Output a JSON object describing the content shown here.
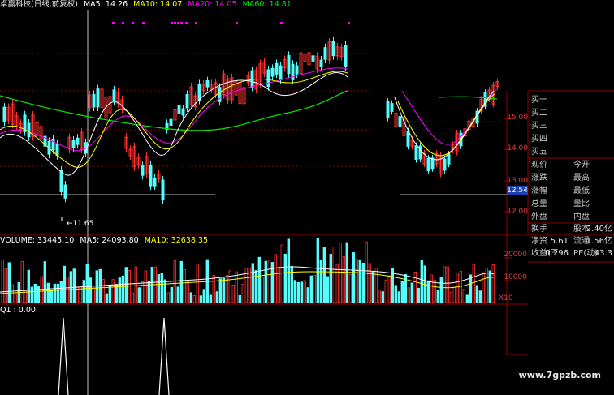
{
  "header": {
    "title": "卓赢科技(日线,前复权)",
    "ma5": "MA5: 14.26",
    "ma10": "MA10: 14.07",
    "ma20": "MA20: 14.05",
    "ma60": "MA60: 14.81"
  },
  "volume_header": {
    "volume": "VOLUME: 33445.10",
    "ma5": "MA5: 24093.80",
    "ma10": "MA10: 32638.35"
  },
  "indicator_header": "Q1 : 0.00",
  "low_marker": "11.65",
  "price_axis": [
    "15.00",
    "14.00",
    "13.00",
    "12.00"
  ],
  "volume_axis": [
    "20000",
    "10000"
  ],
  "volume_unit": "X10",
  "current_price_tag": "12.54",
  "order_book": [
    "买一",
    "买二",
    "买三",
    "买四",
    "买五"
  ],
  "quote": [
    {
      "l1": "现价",
      "v1": "",
      "l2": "今开",
      "v2": ""
    },
    {
      "l1": "涨跌",
      "v1": "",
      "l2": "最高",
      "v2": ""
    },
    {
      "l1": "涨幅",
      "v1": "",
      "l2": "最低",
      "v2": ""
    },
    {
      "l1": "总量",
      "v1": "",
      "l2": "量比",
      "v2": ""
    },
    {
      "l1": "外盘",
      "v1": "",
      "l2": "内盘",
      "v2": ""
    },
    {
      "l1": "换手",
      "v1": "",
      "l2": "股本",
      "v2": "2.40亿"
    },
    {
      "l1": "净资",
      "v1": "5.61",
      "l2": "流通",
      "v2": "1.56亿"
    },
    {
      "l1": "收益(三",
      "v1": "0.296",
      "l2": "PE(动)",
      "v2": "43.3"
    }
  ],
  "watermark": "www.7gpzb.com",
  "colors": {
    "up": "#ff3232",
    "down": "#54fcfc",
    "ma5": "#ffffff",
    "ma10": "#ffff00",
    "ma20": "#ff00ff",
    "ma60": "#00e600",
    "grid": "#8b0000"
  }
}
